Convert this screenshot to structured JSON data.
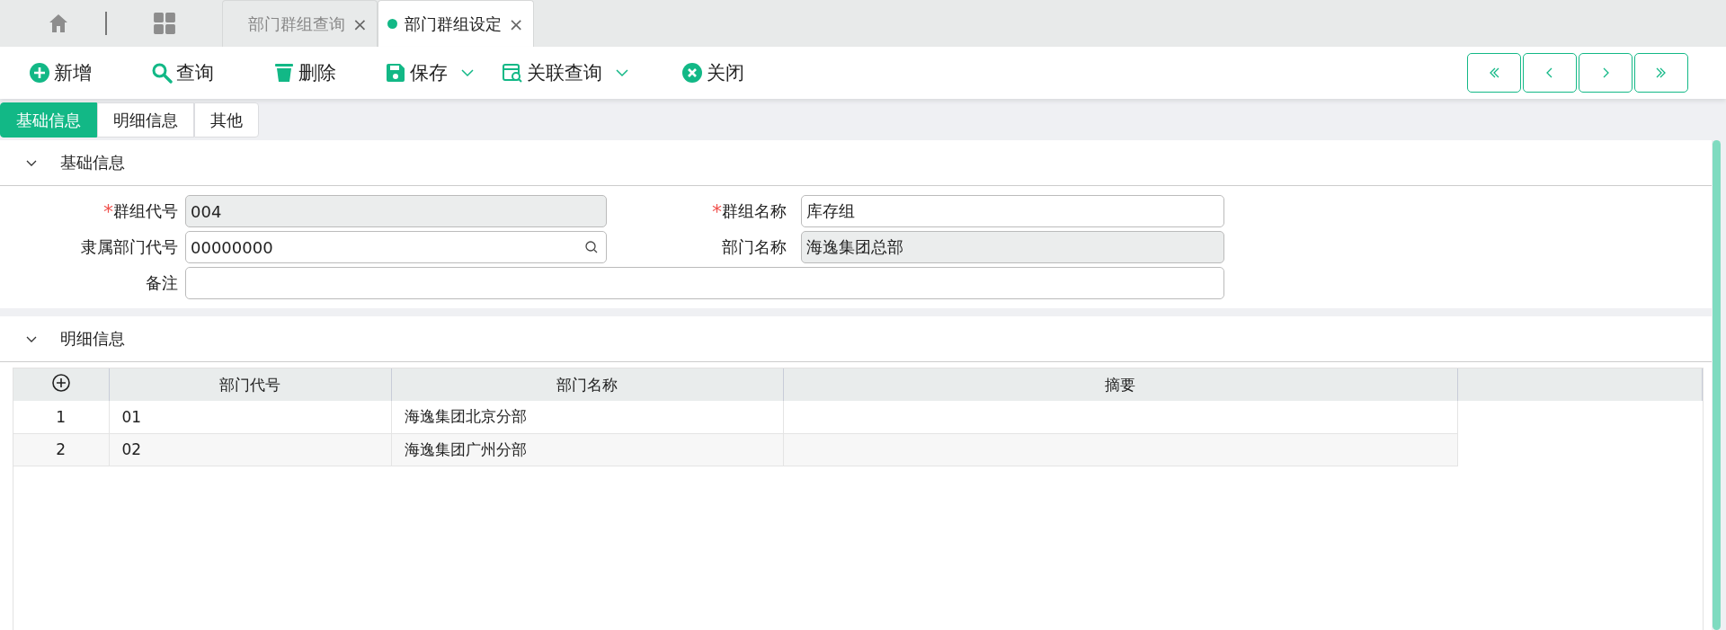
{
  "window_tabs": [
    {
      "label": "部门群组查询",
      "selected": false,
      "close": "×"
    },
    {
      "label": "部门群组设定",
      "selected": true,
      "close": "×"
    }
  ],
  "toolbar": [
    {
      "kind": "add",
      "label": "新增",
      "dropdown": false
    },
    {
      "kind": "search",
      "label": "查询",
      "dropdown": false
    },
    {
      "kind": "delete",
      "label": "删除",
      "dropdown": false
    },
    {
      "kind": "save",
      "label": "保存",
      "dropdown": true
    },
    {
      "kind": "related",
      "label": "关联查询",
      "dropdown": true
    },
    {
      "kind": "close",
      "label": "关闭",
      "dropdown": false
    }
  ],
  "pager": [
    {
      "kind": "first"
    },
    {
      "kind": "prev"
    },
    {
      "kind": "next"
    },
    {
      "kind": "last"
    }
  ],
  "form_tabs": [
    {
      "label": "基础信息",
      "selected": true
    },
    {
      "label": "明细信息",
      "selected": false
    },
    {
      "label": "其他",
      "selected": false
    }
  ],
  "basic_section": {
    "title": "基础信息",
    "expanded": true,
    "fields": [
      {
        "label": "群组代号",
        "required_mark": "*",
        "value": "004",
        "readonly": true,
        "lookup": false,
        "wide": false
      },
      {
        "label": "群组名称",
        "required_mark": "*",
        "value": "库存组",
        "readonly": false,
        "lookup": false,
        "wide": false
      },
      {
        "label": "隶属部门代号",
        "value": "00000000",
        "readonly": false,
        "lookup": true,
        "wide": false
      },
      {
        "label": "部门名称",
        "value": "海逸集团总部",
        "readonly": true,
        "lookup": false,
        "wide": false
      },
      {
        "label": "备注",
        "readonly": false,
        "lookup": false,
        "wide": true
      }
    ]
  },
  "detail_section": {
    "title": "明细信息",
    "expanded": true,
    "table": {
      "columns": [
        "部门代号",
        "部门名称",
        "摘要"
      ],
      "rows": [
        {
          "index": "1",
          "cells": [
            "01",
            "海逸集团北京分部",
            null
          ]
        },
        {
          "index": "2",
          "cells": [
            "02",
            "海逸集团广州分部",
            null
          ]
        }
      ]
    }
  }
}
